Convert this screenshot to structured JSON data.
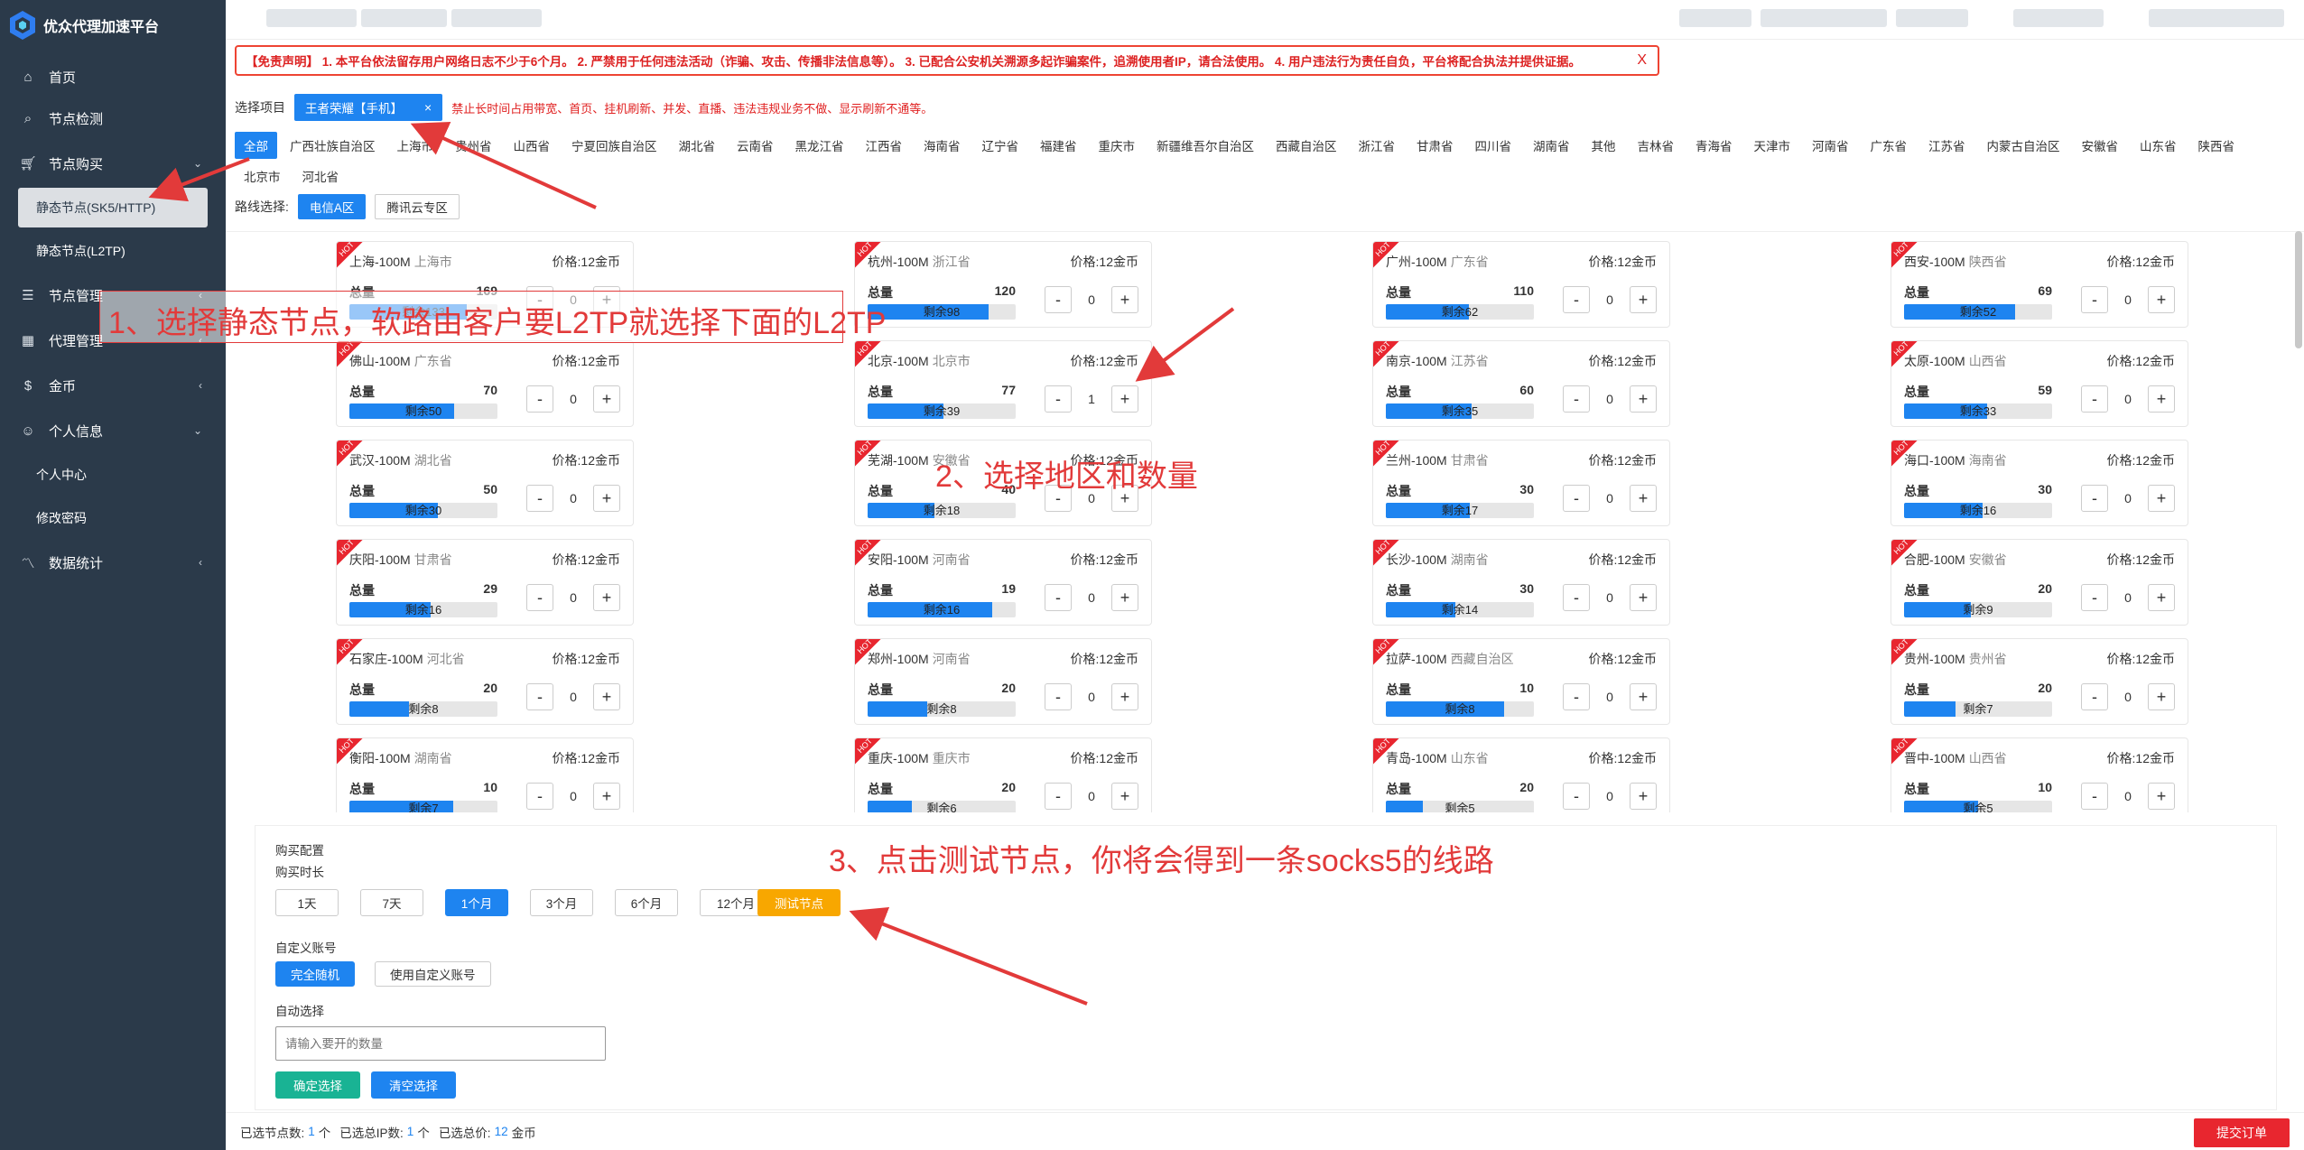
{
  "app": {
    "title": "优众代理加速平台"
  },
  "sidebar": {
    "items": [
      {
        "label": "首页",
        "icon": "home-icon"
      },
      {
        "label": "节点检测",
        "icon": "search-icon"
      },
      {
        "label": "节点购买",
        "icon": "cart-icon"
      },
      {
        "label": "节点管理",
        "icon": "list-icon"
      },
      {
        "label": "代理管理",
        "icon": "grid-icon"
      },
      {
        "label": "金币",
        "icon": "dollar-icon"
      },
      {
        "label": "个人信息",
        "icon": "user-icon"
      },
      {
        "label": "数据统计",
        "icon": "chart-icon"
      }
    ],
    "sub_purchase": [
      "静态节点(SK5/HTTP)",
      "静态节点(L2TP)"
    ],
    "sub_personal": [
      "个人中心",
      "修改密码"
    ]
  },
  "notice": {
    "text": "【免责声明】 1. 本平台依法留存用户网络日志不少于6个月。 2. 严禁用于任何违法活动（诈骗、攻击、传播非法信息等）。 3. 已配合公安机关溯源多起诈骗案件，追溯使用者IP，请合法使用。 4. 用户违法行为责任自负，平台将配合执法并提供证据。",
    "close": "X"
  },
  "project": {
    "label": "选择项目",
    "selected": "王者荣耀【手机】",
    "close": "×",
    "warning": "禁止长时间占用带宽、首页、挂机刷新、并发、直播、违法违规业务不做、显示刷新不通等。"
  },
  "regions": [
    "全部",
    "广西壮族自治区",
    "上海市",
    "贵州省",
    "山西省",
    "宁夏回族自治区",
    "湖北省",
    "云南省",
    "黑龙江省",
    "江西省",
    "海南省",
    "辽宁省",
    "福建省",
    "重庆市",
    "新疆维吾尔自治区",
    "西藏自治区",
    "浙江省",
    "甘肃省",
    "四川省",
    "湖南省",
    "其他",
    "吉林省",
    "青海省",
    "天津市",
    "河南省",
    "广东省",
    "江苏省",
    "内蒙古自治区",
    "安徽省",
    "山东省",
    "陕西省",
    "北京市",
    "河北省"
  ],
  "lines": {
    "label": "路线选择:",
    "options": [
      "电信A区",
      "腾讯云专区"
    ]
  },
  "card_labels": {
    "total": "总量",
    "remain_prefix": "剩余",
    "price": "价格:12金币",
    "ribbon": "HOT",
    "minus": "-",
    "plus": "+"
  },
  "nodes": [
    {
      "city": "上海-100M",
      "prov": "上海市",
      "total": 169,
      "remain": 133,
      "qty": 0
    },
    {
      "city": "杭州-100M",
      "prov": "浙江省",
      "total": 120,
      "remain": 98,
      "qty": 0
    },
    {
      "city": "广州-100M",
      "prov": "广东省",
      "total": 110,
      "remain": 62,
      "qty": 0
    },
    {
      "city": "西安-100M",
      "prov": "陕西省",
      "total": 69,
      "remain": 52,
      "qty": 0
    },
    {
      "city": "佛山-100M",
      "prov": "广东省",
      "total": 70,
      "remain": 50,
      "qty": 0
    },
    {
      "city": "北京-100M",
      "prov": "北京市",
      "total": 77,
      "remain": 39,
      "qty": 1
    },
    {
      "city": "南京-100M",
      "prov": "江苏省",
      "total": 60,
      "remain": 35,
      "qty": 0
    },
    {
      "city": "太原-100M",
      "prov": "山西省",
      "total": 59,
      "remain": 33,
      "qty": 0
    },
    {
      "city": "武汉-100M",
      "prov": "湖北省",
      "total": 50,
      "remain": 30,
      "qty": 0
    },
    {
      "city": "芜湖-100M",
      "prov": "安徽省",
      "total": 40,
      "remain": 18,
      "qty": 0
    },
    {
      "city": "兰州-100M",
      "prov": "甘肃省",
      "total": 30,
      "remain": 17,
      "qty": 0
    },
    {
      "city": "海口-100M",
      "prov": "海南省",
      "total": 30,
      "remain": 16,
      "qty": 0
    },
    {
      "city": "庆阳-100M",
      "prov": "甘肃省",
      "total": 29,
      "remain": 16,
      "qty": 0
    },
    {
      "city": "安阳-100M",
      "prov": "河南省",
      "total": 19,
      "remain": 16,
      "qty": 0
    },
    {
      "city": "长沙-100M",
      "prov": "湖南省",
      "total": 30,
      "remain": 14,
      "qty": 0
    },
    {
      "city": "合肥-100M",
      "prov": "安徽省",
      "total": 20,
      "remain": 9,
      "qty": 0
    },
    {
      "city": "石家庄-100M",
      "prov": "河北省",
      "total": 20,
      "remain": 8,
      "qty": 0
    },
    {
      "city": "郑州-100M",
      "prov": "河南省",
      "total": 20,
      "remain": 8,
      "qty": 0
    },
    {
      "city": "拉萨-100M",
      "prov": "西藏自治区",
      "total": 10,
      "remain": 8,
      "qty": 0
    },
    {
      "city": "贵州-100M",
      "prov": "贵州省",
      "total": 20,
      "remain": 7,
      "qty": 0
    },
    {
      "city": "衡阳-100M",
      "prov": "湖南省",
      "total": 10,
      "remain": 7,
      "qty": 0
    },
    {
      "city": "重庆-100M",
      "prov": "重庆市",
      "total": 20,
      "remain": 6,
      "qty": 0
    },
    {
      "city": "青岛-100M",
      "prov": "山东省",
      "total": 20,
      "remain": 5,
      "qty": 0
    },
    {
      "city": "晋中-100M",
      "prov": "山西省",
      "total": 10,
      "remain": 5,
      "qty": 0
    }
  ],
  "buy": {
    "title": "购买配置",
    "duration_label": "购买时长",
    "durations": [
      "1天",
      "7天",
      "1个月",
      "3个月",
      "6个月",
      "12个月"
    ],
    "selected_duration": "1个月",
    "test_button": "测试节点",
    "account_label": "自定义账号",
    "account_options": [
      "完全随机",
      "使用自定义账号"
    ],
    "auto_label": "自动选择",
    "auto_placeholder": "请输入要开的数量",
    "confirm": "确定选择",
    "clear": "清空选择"
  },
  "footer": {
    "nodes_label": "已选节点数:",
    "nodes": "1",
    "unit": "个",
    "ips_label": "已选总IP数:",
    "ips": "1",
    "price_label": "已选总价:",
    "price": "12",
    "price_unit": "金币",
    "submit": "提交订单"
  },
  "annotations": {
    "a1": "1、选择静态节点，软路由客户要L2TP就选择下面的L2TP",
    "a2": "2、选择地区和数量",
    "a3": "3、点击测试节点，你将会得到一条socks5的线路",
    "color": "#e23a3a"
  }
}
